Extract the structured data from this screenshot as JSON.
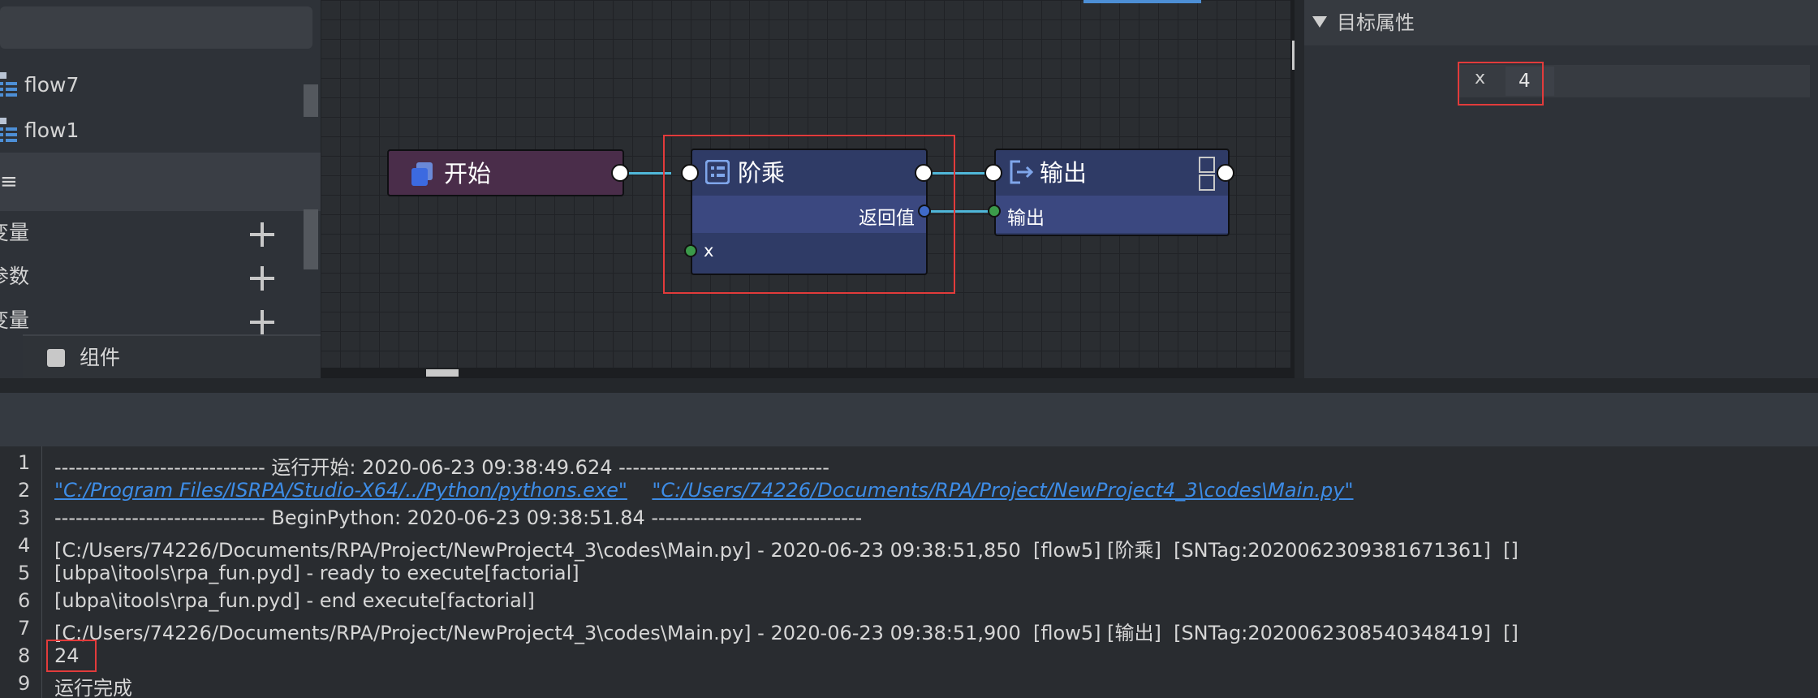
{
  "left_panel": {
    "flows": [
      {
        "label": "flow7"
      },
      {
        "label": "flow1"
      }
    ],
    "variables_header": "≡",
    "var_rows": [
      {
        "label": "变量"
      },
      {
        "label": "参数"
      },
      {
        "label": "变量"
      }
    ],
    "component_label": "组件"
  },
  "canvas": {
    "nodes": {
      "start": {
        "title": "开始"
      },
      "factorial": {
        "title": "阶乘",
        "return_label": "返回值",
        "param_label": "x"
      },
      "output": {
        "title": "输出",
        "input_label": "输出"
      }
    },
    "colors": {
      "wire": "#4fb7d9",
      "start_bg": "#4a2d4a",
      "node_bg": "#2f3b66",
      "highlight": "#e23b3b"
    }
  },
  "right_panel": {
    "header": "目标属性",
    "property": {
      "label": "x",
      "value": "4"
    }
  },
  "console": {
    "lines": [
      {
        "n": "1",
        "text": "------------------------------ 运行开始: 2020-06-23 09:38:49.624 ------------------------------"
      },
      {
        "n": "2",
        "link1": "\"C:/Program Files/ISRPA/Studio-X64/../Python/pythons.exe\"",
        "link2": "\"C:/Users/74226/Documents/RPA/Project/NewProject4_3\\codes\\Main.py\""
      },
      {
        "n": "3",
        "text": "------------------------------ BeginPython: 2020-06-23 09:38:51.84 ------------------------------"
      },
      {
        "n": "4",
        "text": "[C:/Users/74226/Documents/RPA/Project/NewProject4_3\\codes\\Main.py] - 2020-06-23 09:38:51,850  [flow5] [阶乘]  [SNTag:20200623093816713​61]  []"
      },
      {
        "n": "5",
        "text": "[ubpa\\itools\\rpa_fun.pyd] - ready to execute[factorial]"
      },
      {
        "n": "6",
        "text": "[ubpa\\itools\\rpa_fun.pyd] - end execute[factorial]"
      },
      {
        "n": "7",
        "text": "[C:/Users/74226/Documents/RPA/Project/NewProject4_3\\codes\\Main.py] - 2020-06-23 09:38:51,900  [flow5] [输出]  [SNTag:20200623085403484​19]  []"
      },
      {
        "n": "8",
        "text": "24"
      },
      {
        "n": "9",
        "text": "运行完成"
      }
    ]
  }
}
